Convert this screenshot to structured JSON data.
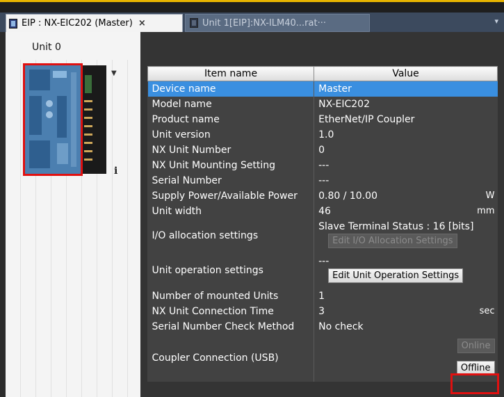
{
  "tabs": [
    {
      "label": "EIP : NX-EIC202 (Master)",
      "close": "×",
      "icon": "device-icon"
    },
    {
      "label": "Unit 1[EIP]:NX-ILM40...rat···",
      "icon": "device-icon"
    }
  ],
  "tab_overflow_icon": "▾",
  "left_panel": {
    "unit_label": "Unit 0",
    "info_glyph": "i",
    "scroll_glyph": "▼"
  },
  "table": {
    "headers": {
      "name": "Item name",
      "value": "Value"
    },
    "rows": [
      {
        "name": "Device name",
        "value": "Master"
      },
      {
        "name": "Model name",
        "value": "NX-EIC202"
      },
      {
        "name": "Product name",
        "value": "EtherNet/IP Coupler"
      },
      {
        "name": "Unit version",
        "value": "1.0"
      },
      {
        "name": "NX Unit Number",
        "value": "0"
      },
      {
        "name": "NX Unit Mounting Setting",
        "value": "---"
      },
      {
        "name": "Serial Number",
        "value": "---"
      },
      {
        "name": "Supply Power/Available Power",
        "value": "0.80 / 10.00",
        "unit": "W"
      },
      {
        "name": "Unit width",
        "value": "46",
        "unit": "mm"
      },
      {
        "name": "I/O allocation settings",
        "value": "Slave Terminal Status : 16 [bits]",
        "button": "Edit I/O Allocation Settings"
      },
      {
        "name": "Unit operation settings",
        "value": "---",
        "button": "Edit Unit Operation Settings"
      },
      {
        "name": "Number of mounted Units",
        "value": "1"
      },
      {
        "name": "NX Unit Connection Time",
        "value": "3",
        "unit": "sec"
      },
      {
        "name": "Serial Number Check Method",
        "value": "No check"
      },
      {
        "name": "Coupler Connection (USB)",
        "online_button": "Online",
        "offline_button": "Offline"
      }
    ]
  },
  "colors": {
    "selection": "#3a8fe0",
    "highlight": "#e01010",
    "accent_strip": "#e8b400"
  }
}
